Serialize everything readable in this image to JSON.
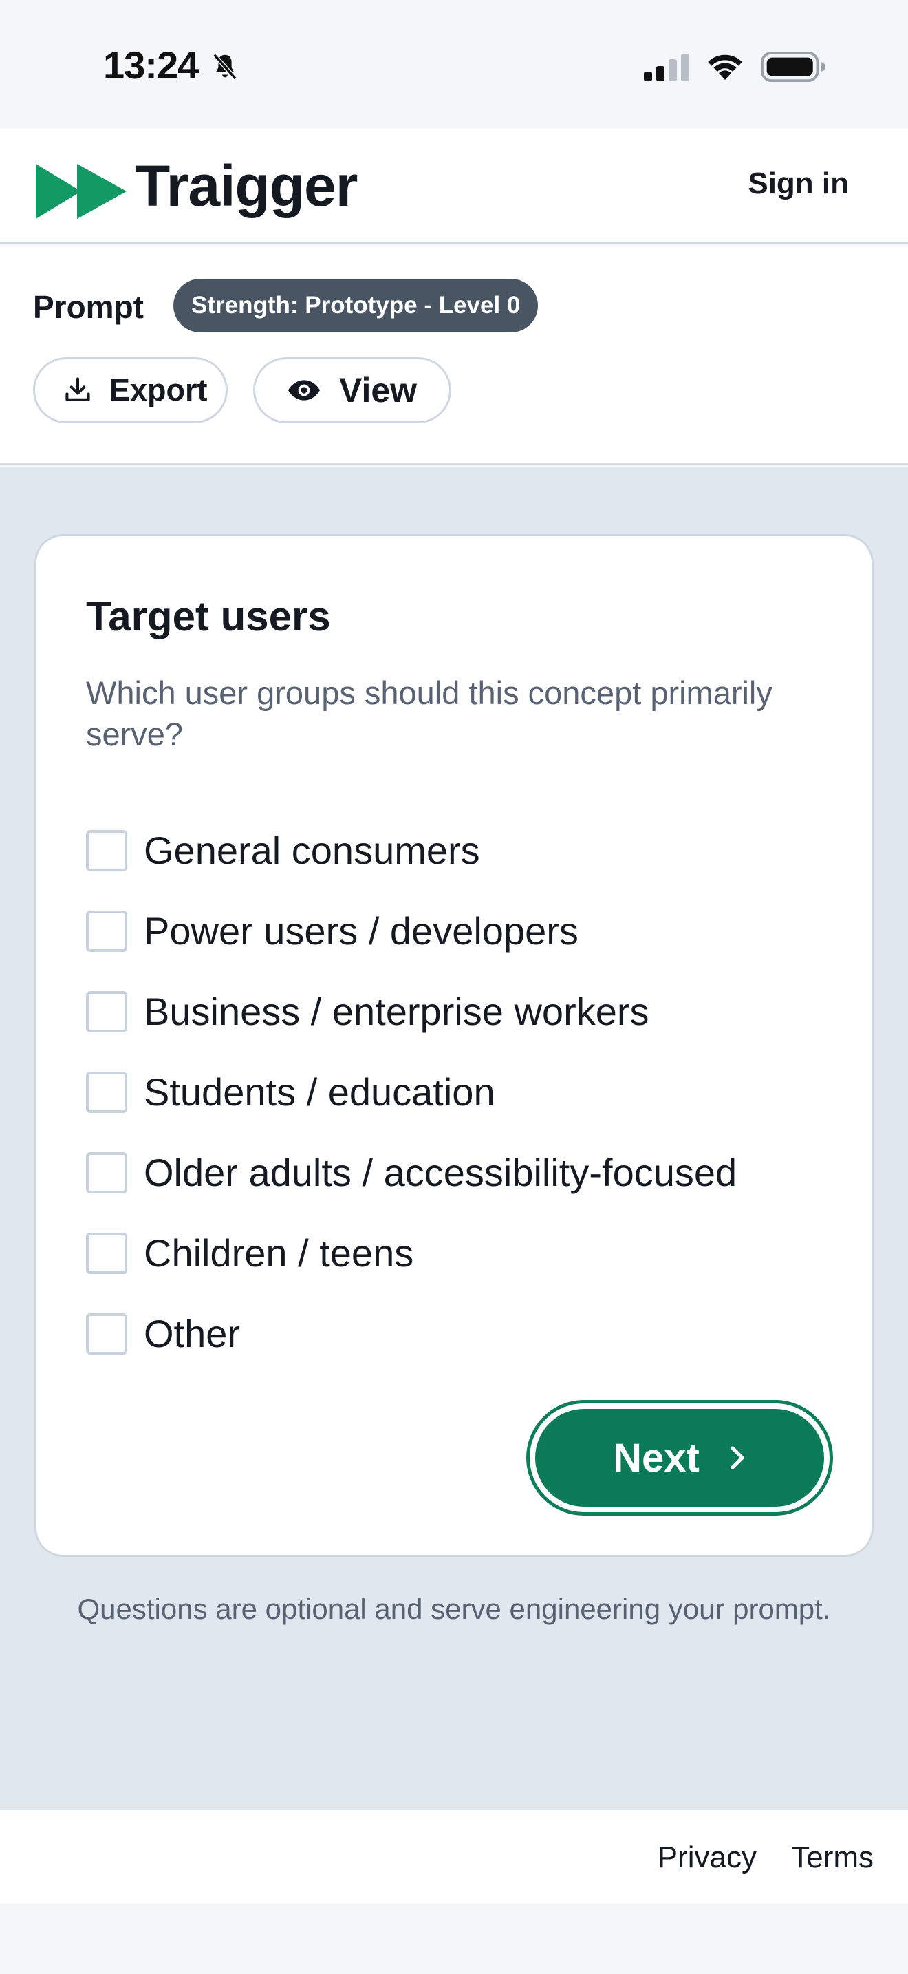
{
  "status_bar": {
    "time": "13:24",
    "icons": [
      "bell-slash-icon",
      "cellular-signal-icon",
      "wifi-icon",
      "battery-icon"
    ]
  },
  "header": {
    "brand": "Traigger",
    "logo_icon": "double-play-logo-icon",
    "sign_in_label": "Sign in"
  },
  "prompt_bar": {
    "label": "Prompt",
    "strength_badge": "Strength: Prototype - Level 0",
    "export_label": "Export",
    "export_icon": "download-icon",
    "view_label": "View",
    "view_icon": "eye-icon"
  },
  "question": {
    "title": "Target users",
    "description": "Which user groups should this concept primarily serve?",
    "options": [
      {
        "label": "General consumers",
        "checked": false
      },
      {
        "label": "Power users / developers",
        "checked": false
      },
      {
        "label": "Business / enterprise workers",
        "checked": false
      },
      {
        "label": "Students / education",
        "checked": false
      },
      {
        "label": "Older adults / accessibility-focused",
        "checked": false
      },
      {
        "label": "Children / teens",
        "checked": false
      },
      {
        "label": "Other",
        "checked": false
      }
    ],
    "next_label": "Next",
    "next_icon": "chevron-right-icon"
  },
  "footnote": "Questions are optional and serve engineering your prompt.",
  "footer": {
    "privacy_label": "Privacy",
    "terms_label": "Terms"
  },
  "colors": {
    "brand_green": "#0a7a57",
    "logo_green": "#139964",
    "badge_gray": "#4a5564",
    "page_bg": "#e1e7ef"
  }
}
